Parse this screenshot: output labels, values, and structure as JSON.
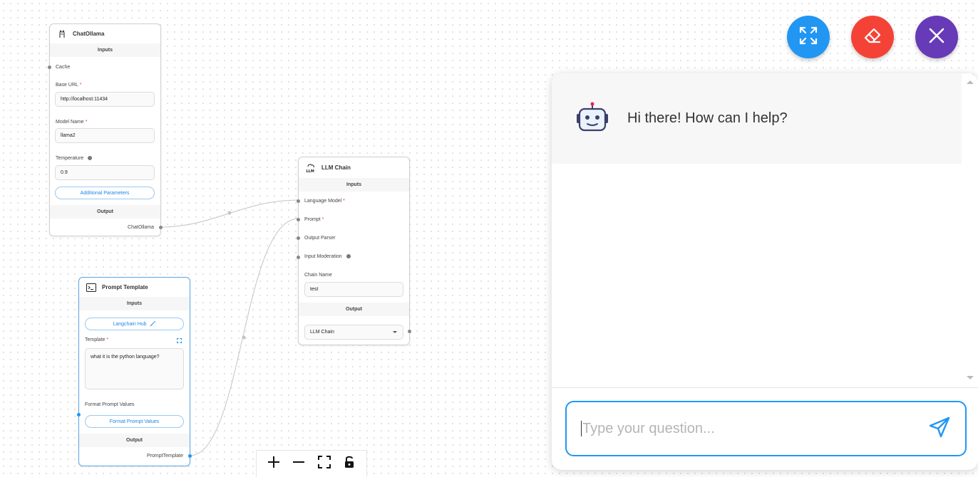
{
  "chat_ollama": {
    "title": "ChatOllama",
    "inputs_label": "Inputs",
    "cache_label": "Cache",
    "base_url_label": "Base URL",
    "base_url_value": "http://localhost:11434",
    "model_name_label": "Model Name",
    "model_name_value": "llama2",
    "temperature_label": "Temperature",
    "temperature_value": "0.9",
    "additional_params": "Additional Parameters",
    "output_label": "Output",
    "output_name": "ChatOllama",
    "required_mark": "*"
  },
  "llm_chain": {
    "title": "LLM Chain",
    "inputs_label": "Inputs",
    "language_model_label": "Language Model",
    "prompt_label": "Prompt",
    "output_parser_label": "Output Parser",
    "input_moderation_label": "Input Moderation",
    "chain_name_label": "Chain Name",
    "chain_name_value": "test",
    "output_label": "Output",
    "output_select": "LLM Chain",
    "required_mark": "*"
  },
  "prompt_template": {
    "title": "Prompt Template",
    "inputs_label": "Inputs",
    "langchain_hub": "Langchain Hub",
    "template_label": "Template",
    "template_value": "what it is the python language?",
    "format_label": "Format Prompt Values",
    "format_button": "Format Prompt Values",
    "output_label": "Output",
    "output_name": "PromptTemplate",
    "required_mark": "*"
  },
  "chat": {
    "greeting": "Hi there! How can I help?",
    "input_placeholder": "Type your question..."
  },
  "colors": {
    "expand": "#2196f3",
    "clear": "#f44336",
    "close": "#673ab7",
    "accent": "#2196f3"
  },
  "icons": {
    "expand": "expand-arrows-icon",
    "clear": "eraser-icon",
    "close": "close-icon",
    "send": "send-icon",
    "bot": "robot-icon",
    "zoom_in": "plus-icon",
    "zoom_out": "minus-icon",
    "fit": "fit-view-icon",
    "lock": "unlock-icon"
  }
}
